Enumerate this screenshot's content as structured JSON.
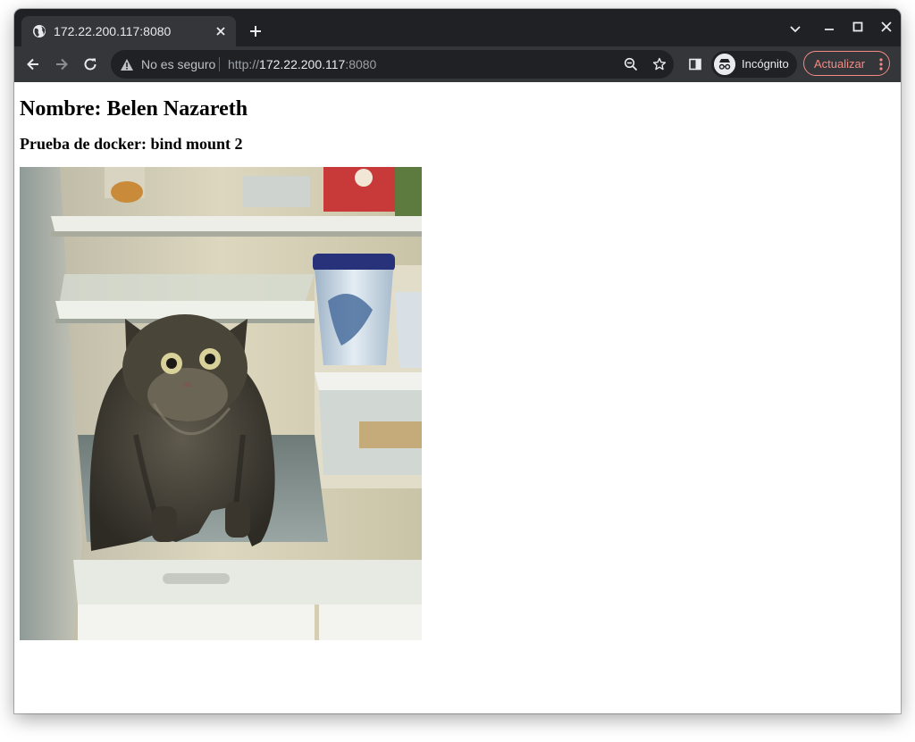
{
  "browser": {
    "tab": {
      "title": "172.22.200.117:8080",
      "favicon": "globe-icon"
    },
    "window_controls": [
      "chevron-down-icon",
      "minimize-icon",
      "maximize-icon",
      "close-icon"
    ],
    "omnibox": {
      "security_label": "No es seguro",
      "url_scheme": "http://",
      "url_host": "172.22.200.117",
      "url_port": ":8080"
    },
    "profile_label": "Incógnito",
    "update_label": "Actualizar",
    "accent_colors": {
      "frame": "#202124",
      "toolbar": "#35363a",
      "update": "#f28b82"
    }
  },
  "page": {
    "heading": "Nombre: Belen Nazareth",
    "subheading": "Prueba de docker: bind mount 2",
    "image": {
      "subject": "cat-in-fridge-photo"
    }
  }
}
